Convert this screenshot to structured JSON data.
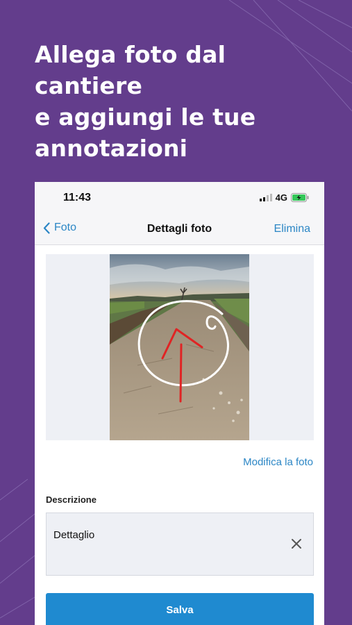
{
  "headline": {
    "line1": "Allega foto dal cantiere",
    "line2": "e aggiungi le tue",
    "line3": "annotazioni"
  },
  "status_bar": {
    "time": "11:43",
    "network": "4G"
  },
  "nav": {
    "back_label": "Foto",
    "title": "Dettagli foto",
    "delete_label": "Elimina"
  },
  "photo": {
    "edit_label": "Modifica la foto"
  },
  "description": {
    "label": "Descrizione",
    "value": "Dettaglio"
  },
  "actions": {
    "save_label": "Salva"
  },
  "colors": {
    "background": "#633d8c",
    "accent": "#2b86c5",
    "primary_button": "#1f8ad0",
    "annotation_red": "#e02424"
  }
}
